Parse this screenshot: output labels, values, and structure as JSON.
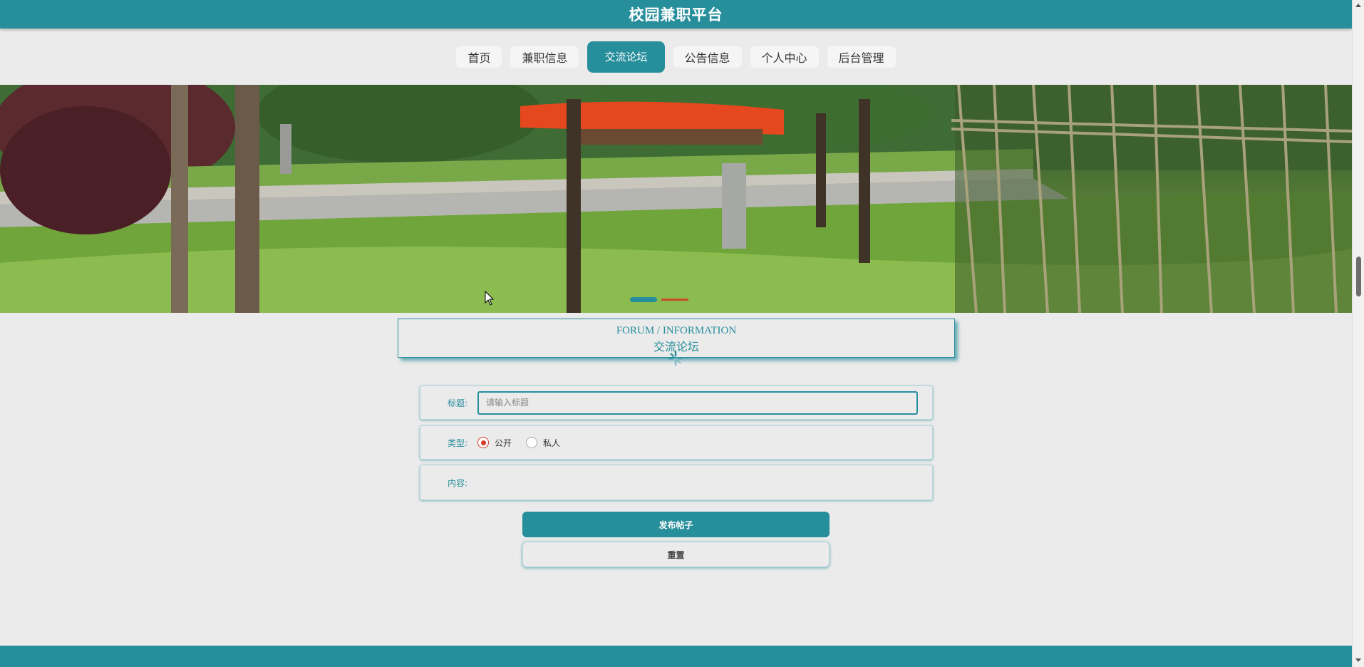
{
  "header": {
    "title": "校园兼职平台"
  },
  "nav": {
    "items": [
      {
        "label": "首页"
      },
      {
        "label": "兼职信息"
      },
      {
        "label": "交流论坛",
        "active": true
      },
      {
        "label": "公告信息"
      },
      {
        "label": "个人中心"
      },
      {
        "label": "后台管理"
      }
    ]
  },
  "section": {
    "title_en": "FORUM / INFORMATION",
    "title_cn": "交流论坛"
  },
  "form": {
    "title_label": "标题:",
    "title_placeholder": "请输入标题",
    "title_value": "",
    "type_label": "类型:",
    "type_options": [
      "公开",
      "私人"
    ],
    "type_selected": "公开",
    "content_label": "内容:"
  },
  "buttons": {
    "submit": "发布帖子",
    "reset": "重置"
  },
  "colors": {
    "accent": "#278e9b",
    "radio_selected": "#d23a2a",
    "background": "#ebebeb"
  }
}
